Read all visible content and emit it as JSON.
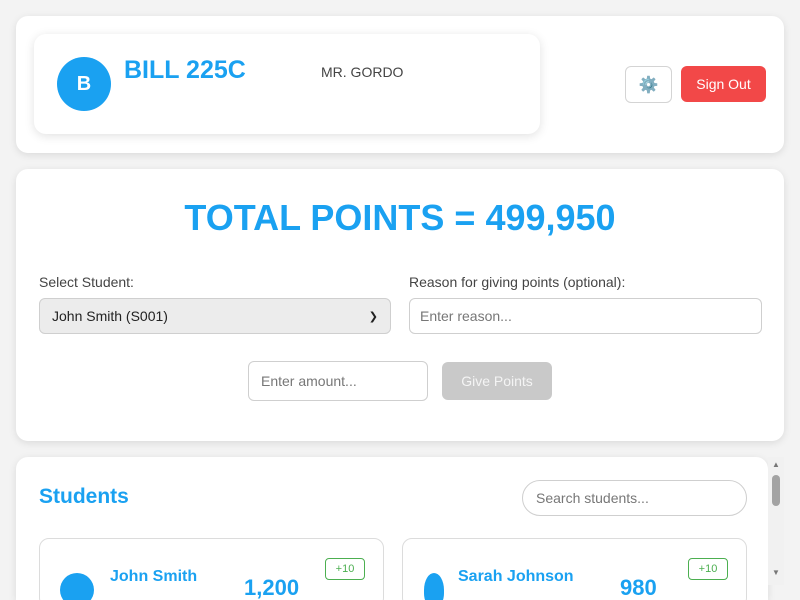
{
  "header": {
    "class_initial": "B",
    "class_title": "BILL 225C",
    "teacher": "MR. GORDO",
    "settings_icon": "gear-icon",
    "settings_glyph": "⚙️",
    "signout_label": "Sign Out"
  },
  "points_panel": {
    "total_points": "TOTAL POINTS = 499,950",
    "student_select_label": "Select Student:",
    "student_select_value": "John Smith (S001)",
    "reason_label": "Reason for giving points (optional):",
    "reason_placeholder": "Enter reason...",
    "amount_placeholder": "Enter amount...",
    "give_points_label": "Give Points"
  },
  "students": {
    "heading": "Students",
    "search_placeholder": "Search students...",
    "items": [
      {
        "name": "John Smith",
        "points": "1,200",
        "badge": "+10"
      },
      {
        "name": "Sarah Johnson",
        "points": "980",
        "badge": "+10"
      }
    ]
  },
  "colors": {
    "accent": "#1aa1f1",
    "danger": "#f24848",
    "success": "#4caf50",
    "disabled": "#c9c9c9"
  }
}
